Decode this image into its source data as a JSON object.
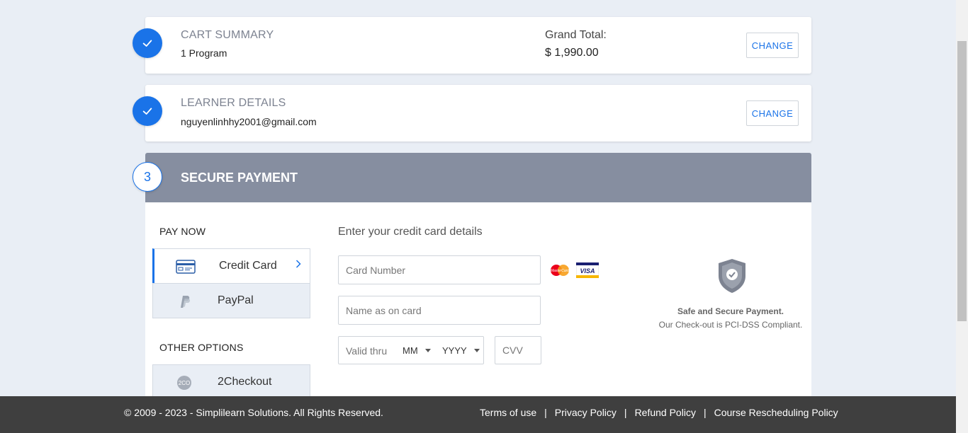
{
  "cart": {
    "title": "CART SUMMARY",
    "subtitle": "1 Program",
    "grand_total_label": "Grand Total:",
    "grand_total_value": "$ 1,990.00",
    "change_label": "CHANGE"
  },
  "learner": {
    "title": "LEARNER DETAILS",
    "email": "nguyenlinhhy2001@gmail.com",
    "change_label": "CHANGE"
  },
  "payment": {
    "step_number": "3",
    "title": "SECURE PAYMENT",
    "pay_now_label": "PAY NOW",
    "methods": [
      {
        "label": "Credit Card",
        "icon": "credit-card-icon",
        "active": true
      },
      {
        "label": "PayPal",
        "icon": "paypal-icon",
        "active": false
      }
    ],
    "other_options_label": "OTHER OPTIONS",
    "other_methods": [
      {
        "label": "2Checkout",
        "icon": "2checkout-icon",
        "icon_text": "2CO"
      }
    ],
    "form": {
      "title": "Enter your credit card details",
      "card_number_placeholder": "Card Number",
      "name_placeholder": "Name as on card",
      "valid_thru_label": "Valid thru",
      "month_selected": "MM",
      "year_selected": "YYYY",
      "cvv_placeholder": "CVV",
      "card_brands": [
        "MasterCard",
        "VISA"
      ]
    },
    "security": {
      "title": "Safe and Secure Payment.",
      "subtitle": "Our Check-out is PCI-DSS Compliant."
    }
  },
  "footer": {
    "copyright": "© 2009 - 2023 - Simplilearn Solutions. All Rights Reserved.",
    "links": [
      "Terms of use",
      "Privacy Policy",
      "Refund Policy",
      "Course Rescheduling Policy"
    ],
    "separator": "|"
  },
  "colors": {
    "accent": "#1a73e8",
    "payment_header": "#868ea0",
    "page_bg": "#e9eef5",
    "footer_bg": "#3f3f3f"
  }
}
